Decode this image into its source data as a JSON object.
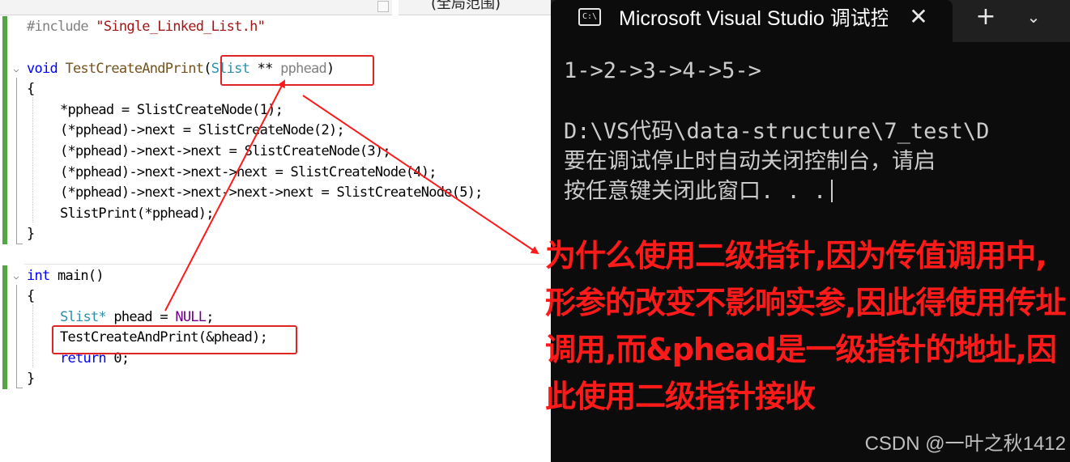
{
  "editor": {
    "tab_right_label": "(全局范围)",
    "code_lines": {
      "include_directive": "#include",
      "include_file": "\"Single_Linked_List.h\"",
      "fn_void": "void",
      "fn_name": "TestCreateAndPrint",
      "fn_param_type": "Slist",
      "fn_param_stars": "**",
      "fn_param_name": "pphead",
      "brace_open": "{",
      "brace_close": "}",
      "line_1": "*pphead = SlistCreateNode(1);",
      "line_2": "(*pphead)->next = SlistCreateNode(2);",
      "line_3": "(*pphead)->next->next = SlistCreateNode(3);",
      "line_4": "(*pphead)->next->next->next = SlistCreateNode(4);",
      "line_5": "(*pphead)->next->next->next->next = SlistCreateNode(5);",
      "line_6": "SlistPrint(*pphead);",
      "main_int": "int",
      "main_name": "main()",
      "main_decl_type": "Slist*",
      "main_decl_name": "phead",
      "main_decl_null": "NULL",
      "main_call": "TestCreateAndPrint(&phead);",
      "main_return": "return",
      "main_return_val": "0;"
    }
  },
  "terminal": {
    "tab_icon_text": "C:\\",
    "title": "Microsoft Visual Studio 调试控制台",
    "close_glyph": "✕",
    "new_tab_glyph": "+",
    "dropdown_glyph": "⌄",
    "output_line": "1->2->3->4->5->",
    "path_line": "D:\\VS代码\\data-structure\\7_test\\D",
    "hint_line": "要在调试停止时自动关闭控制台，请启",
    "press_key_line": "按任意键关闭此窗口. . ."
  },
  "annotation": {
    "text": "为什么使用二级指针,因为传值调用中,形参的改变不影响实参,因此得使用传址调用,而&phead是一级指针的地址,因此使用二级指针接收"
  },
  "watermark": "CSDN @一叶之秋1412",
  "colors": {
    "annotation": "#ff1a1a",
    "terminal_bg": "#0c0c0c",
    "keyword": "#0000ff",
    "type": "#2b91af",
    "function": "#74531f",
    "change_bar": "#53a546"
  }
}
